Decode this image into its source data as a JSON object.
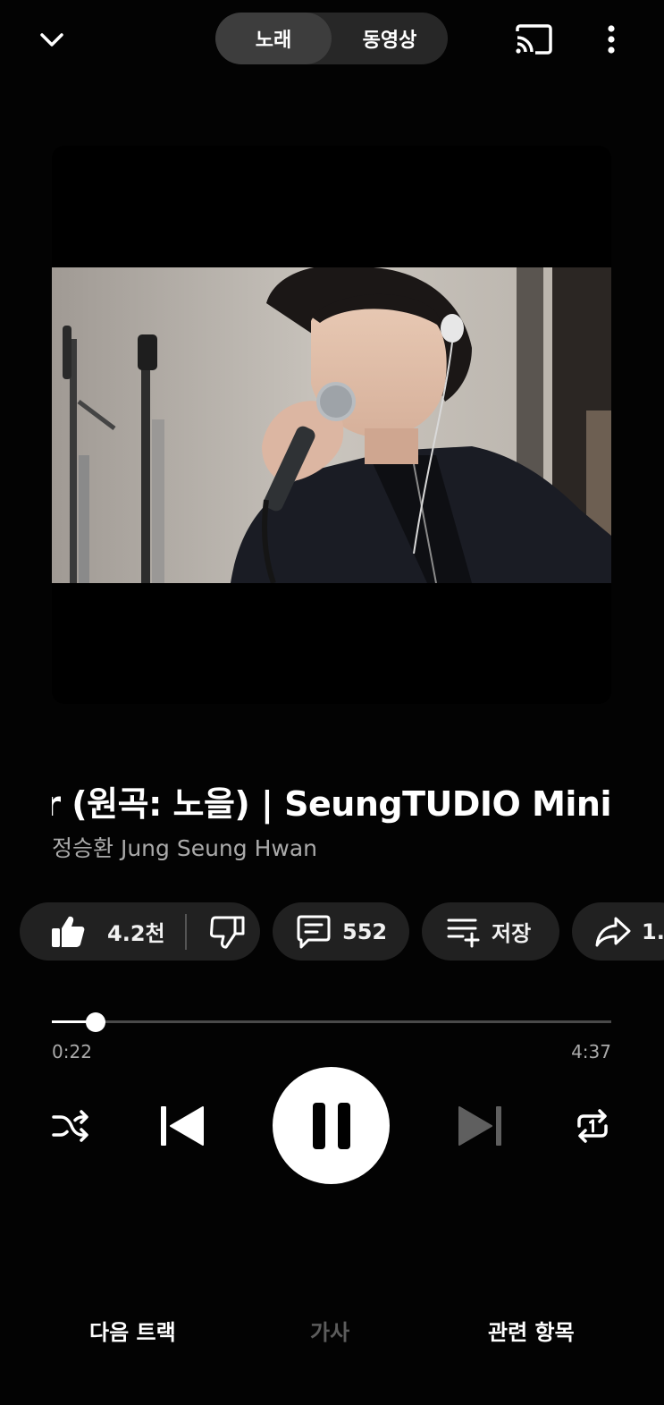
{
  "header": {
    "tabs": [
      {
        "label": "노래",
        "active": true
      },
      {
        "label": "동영상",
        "active": false
      }
    ],
    "icons": [
      "chevron-down-icon",
      "cast-icon",
      "more-vert-icon"
    ]
  },
  "song": {
    "title": "r (원곡: 노을) | SeungTUDIO Mini",
    "artist": "정승환 Jung Seung Hwan"
  },
  "actions": {
    "like_count": "4.2천",
    "comment_count": "552",
    "save_label": "저장",
    "share_label": "1."
  },
  "player": {
    "current_time": "0:22",
    "total_time": "4:37",
    "progress": 0.078,
    "state": "playing"
  },
  "bottom_tabs": [
    {
      "label": "다음 트랙",
      "enabled": true
    },
    {
      "label": "가사",
      "enabled": false
    },
    {
      "label": "관련 항목",
      "enabled": true
    }
  ],
  "colors": {
    "background": "#030303",
    "chip": "#212121",
    "segment_bg": "#272727",
    "segment_active": "#3d3d3d",
    "secondary_text": "#aaaaaa",
    "disabled_text": "#5c5c5c"
  }
}
